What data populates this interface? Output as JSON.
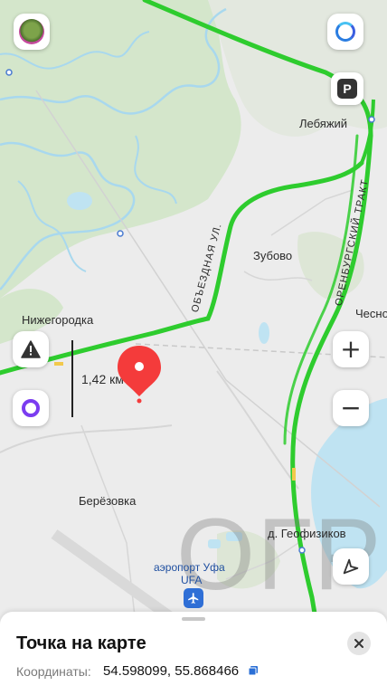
{
  "map": {
    "place_labels": {
      "lebyazhiy": "Лебяжий",
      "zubovo": "Зубово",
      "nizhegorodka": "Нижегородка",
      "chesno": "Чесно",
      "berezovka": "Берёзовка",
      "geofizikov": "д. Геофизиков",
      "airport_line1": "аэропорт Уфа",
      "airport_line2": "UFA"
    },
    "road_labels": {
      "obezdnaya": "ОБЪЕЗДНАЯ УЛ.",
      "orenburgsky": "ОРЕНБУРГСКИЙ ТРАКТ"
    },
    "scale_text": "1,42 км",
    "watermark": "ОГР",
    "colors": {
      "water": "#bfe3f2",
      "forest": "#cfe3c6",
      "road_green": "#2ecc2e",
      "pin_red": "#f43b3b",
      "alice_purple": "#7b3cf0"
    }
  },
  "controls": {
    "parking_label": "P",
    "zoom_in": "+",
    "zoom_out": "−",
    "icons": [
      "profile-avatar",
      "alice-ring-icon",
      "parking-icon",
      "warning-icon",
      "alice-assistant-icon",
      "zoom-in-icon",
      "zoom-out-icon",
      "navigation-arrow-icon",
      "airport-plane-icon",
      "copy-icon",
      "close-icon",
      "location-pin-icon"
    ]
  },
  "sheet": {
    "title": "Точка на карте",
    "coords_label": "Координаты:",
    "coords_value": "54.598099, 55.868466"
  }
}
